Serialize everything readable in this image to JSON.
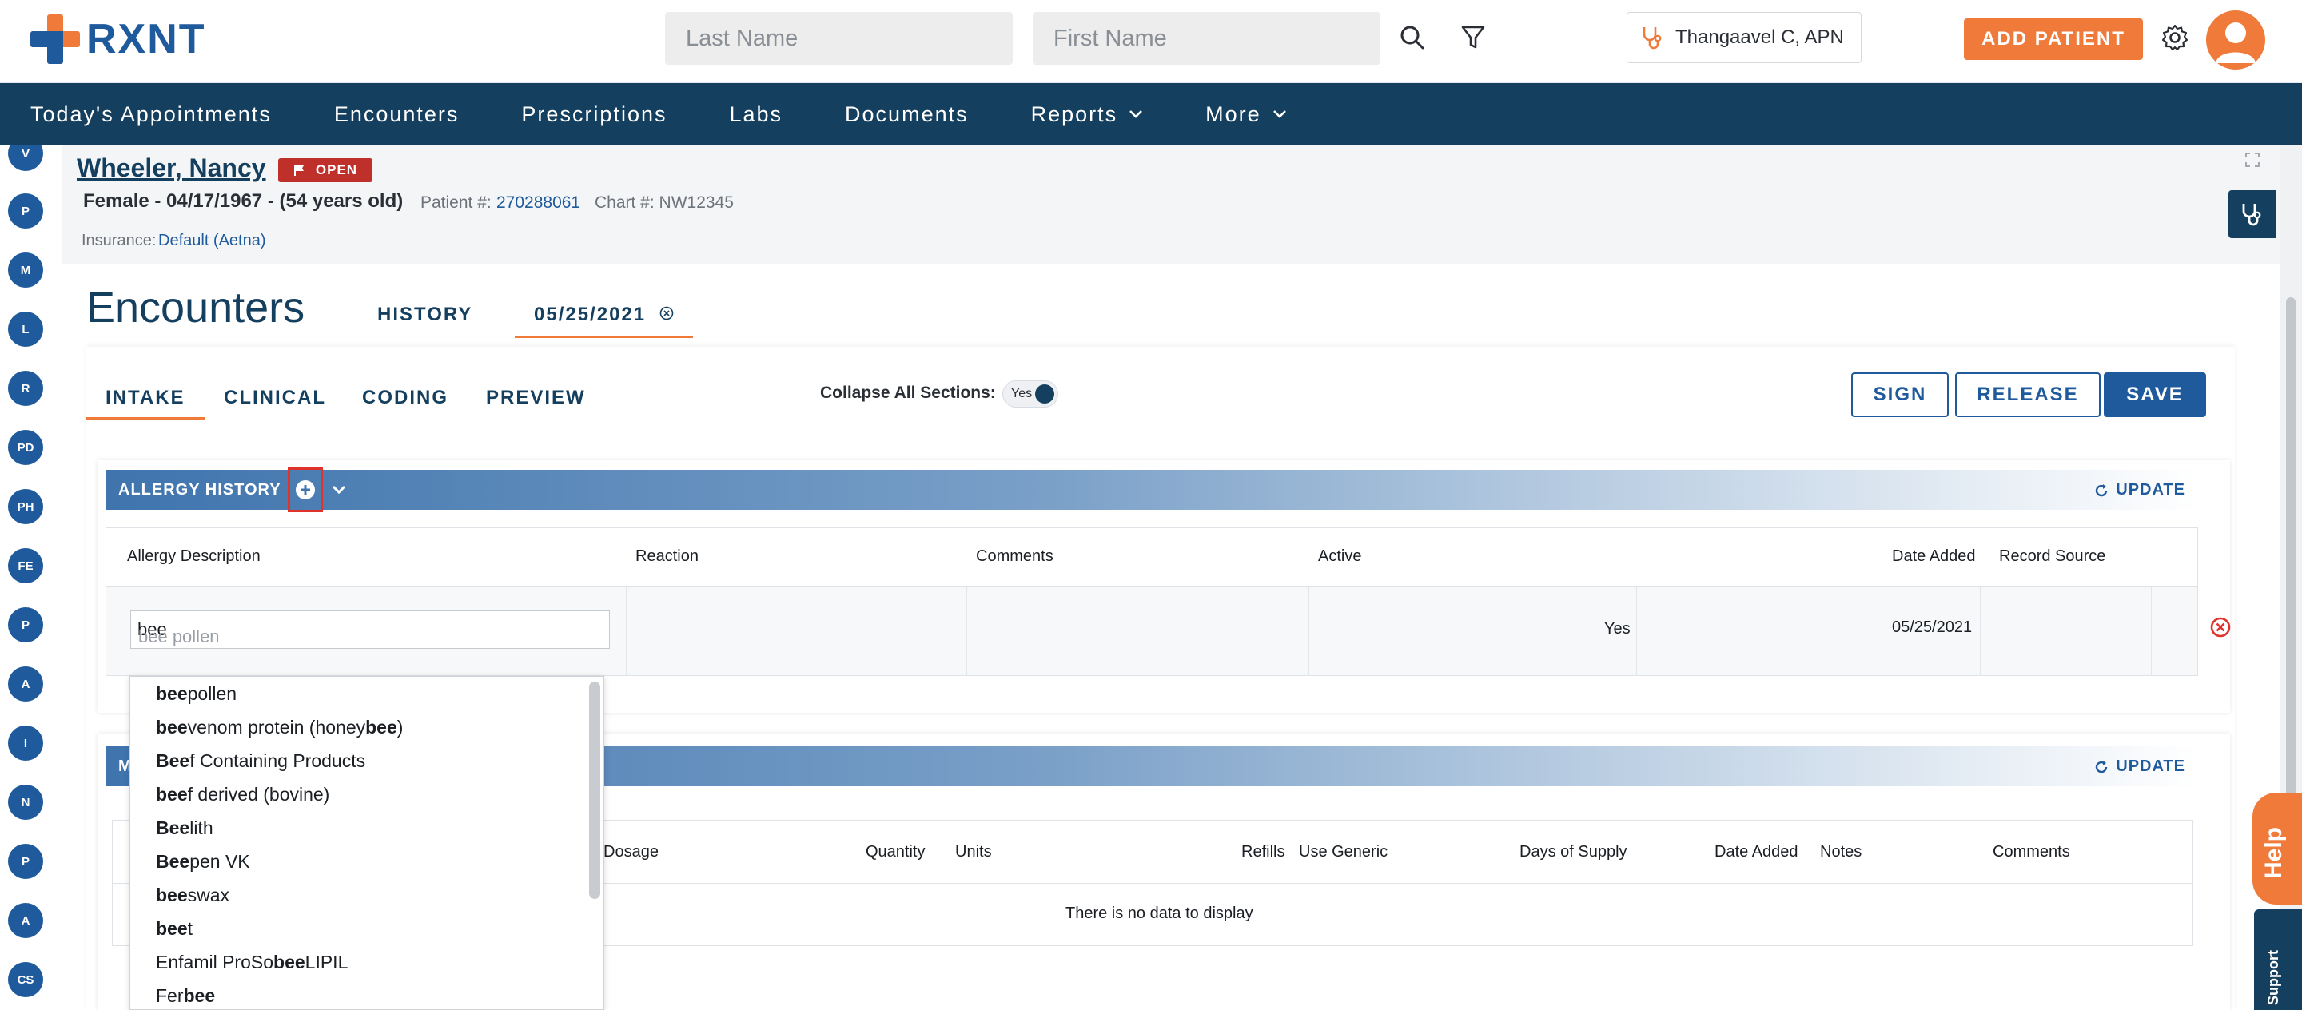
{
  "header": {
    "logo_text": "RXNT",
    "last_name_placeholder": "Last Name",
    "first_name_placeholder": "First Name",
    "provider": "Thangaavel C, APN",
    "add_patient": "ADD PATIENT"
  },
  "nav": {
    "items": [
      {
        "label": "Today's Appointments"
      },
      {
        "label": "Encounters"
      },
      {
        "label": "Prescriptions"
      },
      {
        "label": "Labs"
      },
      {
        "label": "Documents"
      },
      {
        "label": "Reports"
      },
      {
        "label": "More"
      }
    ]
  },
  "rail": [
    "V",
    "P",
    "M",
    "L",
    "R",
    "PD",
    "PH",
    "FE",
    "P",
    "A",
    "I",
    "N",
    "P",
    "A",
    "CS"
  ],
  "patient": {
    "name": "Wheeler, Nancy",
    "status": "OPEN",
    "demographics": "Female - 04/17/1967 - (54 years old)",
    "patient_no_label": "Patient #:",
    "patient_no": "270288061",
    "chart_label": "Chart #: NW12345",
    "insurance_label": "Insurance:",
    "insurance": "Default (Aetna)"
  },
  "encounter": {
    "title": "Encounters",
    "tab_history": "HISTORY",
    "tab_date": "05/25/2021",
    "subtabs": [
      "INTAKE",
      "CLINICAL",
      "CODING",
      "PREVIEW"
    ],
    "collapse_label": "Collapse All Sections:",
    "collapse_value": "Yes",
    "sign": "SIGN",
    "release": "RELEASE",
    "save": "SAVE"
  },
  "allergy": {
    "title": "ALLERGY HISTORY",
    "update": "UPDATE",
    "columns": [
      "Allergy Description",
      "Reaction",
      "Comments",
      "Active",
      "Date Added",
      "Record Source"
    ],
    "input_value": "bee",
    "input_hint": "bee pollen",
    "row": {
      "active": "Yes",
      "date_added": "05/25/2021"
    }
  },
  "dropdown": [
    {
      "pre": "",
      "bold": "bee",
      "post": " pollen"
    },
    {
      "pre": "",
      "bold": "bee",
      "post": " venom protein (honey ",
      "bold2": "bee",
      "post2": ")"
    },
    {
      "pre": "",
      "bold": "Bee",
      "post": "f Containing Products"
    },
    {
      "pre": "",
      "bold": "bee",
      "post": "f derived (bovine)"
    },
    {
      "pre": "",
      "bold": "Bee",
      "post": "lith"
    },
    {
      "pre": "",
      "bold": "Bee",
      "post": "pen VK"
    },
    {
      "pre": "",
      "bold": "bee",
      "post": "swax"
    },
    {
      "pre": "",
      "bold": "bee",
      "post": "t"
    },
    {
      "pre": "Enfamil ProSo",
      "bold": "bee",
      "post": " LIPIL"
    },
    {
      "pre": "Fer",
      "bold": "bee",
      "post": ""
    }
  ],
  "meds": {
    "title_initial": "M",
    "update": "UPDATE",
    "columns": [
      "Dosage",
      "Quantity",
      "Units",
      "Refills",
      "Use Generic",
      "Days of Supply",
      "Date Added",
      "Notes",
      "Comments"
    ],
    "empty": "There is no data to display"
  },
  "help": "Help",
  "support": "Support"
}
